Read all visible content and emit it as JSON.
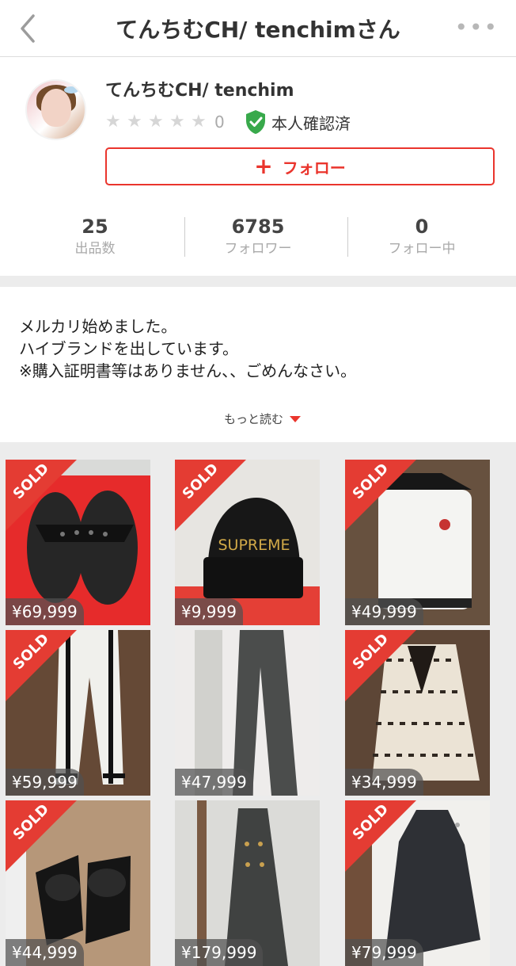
{
  "header": {
    "title": "てんちむCH/ tenchimさん",
    "more_icon": "•••"
  },
  "profile": {
    "username": "てんちむCH/ tenchim",
    "rating_count": "0",
    "verified_label": "本人確認済",
    "follow_label": "フォロー",
    "stats": [
      {
        "value": "25",
        "label": "出品数"
      },
      {
        "value": "6785",
        "label": "フォロワー"
      },
      {
        "value": "0",
        "label": "フォロー中"
      }
    ]
  },
  "description": {
    "lines": [
      "メルカリ始めました。",
      "ハイブランドを出しています。",
      "※購入証明書等はありません、、ごめんなさい。"
    ],
    "read_more": "もっと読む"
  },
  "items": [
    {
      "price": "¥69,999",
      "sold": "SOLD"
    },
    {
      "price": "¥9,999",
      "sold": "SOLD"
    },
    {
      "price": "¥49,999",
      "sold": "SOLD"
    },
    {
      "price": "¥59,999",
      "sold": "SOLD"
    },
    {
      "price": "¥47,999",
      "sold": ""
    },
    {
      "price": "¥34,999",
      "sold": "SOLD"
    },
    {
      "price": "¥44,999",
      "sold": "SOLD"
    },
    {
      "price": "¥179,999",
      "sold": ""
    },
    {
      "price": "¥79,999",
      "sold": "SOLD"
    }
  ]
}
